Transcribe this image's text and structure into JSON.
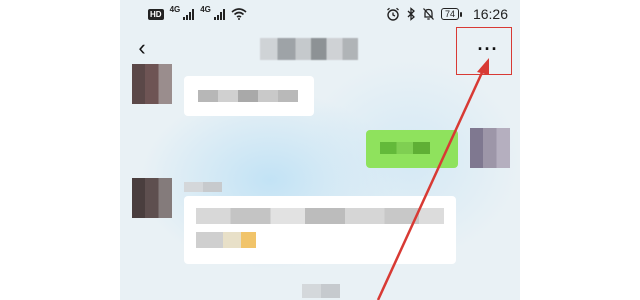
{
  "status_bar": {
    "hd_label": "HD",
    "network_1": "4G",
    "network_2": "4G",
    "battery_level": "74",
    "time": "16:26",
    "icons": [
      "hd-icon",
      "signal-icon",
      "signal-icon",
      "wifi-icon",
      "alarm-icon",
      "bluetooth-icon",
      "mute-icon",
      "battery-icon"
    ]
  },
  "header": {
    "back_symbol": "‹",
    "more_symbol": "···"
  },
  "annotation": {
    "color": "#d83a34"
  },
  "colors": {
    "chat_background": "#e9f1f5",
    "outgoing_bubble": "#8fe25d",
    "incoming_bubble": "#ffffff"
  }
}
